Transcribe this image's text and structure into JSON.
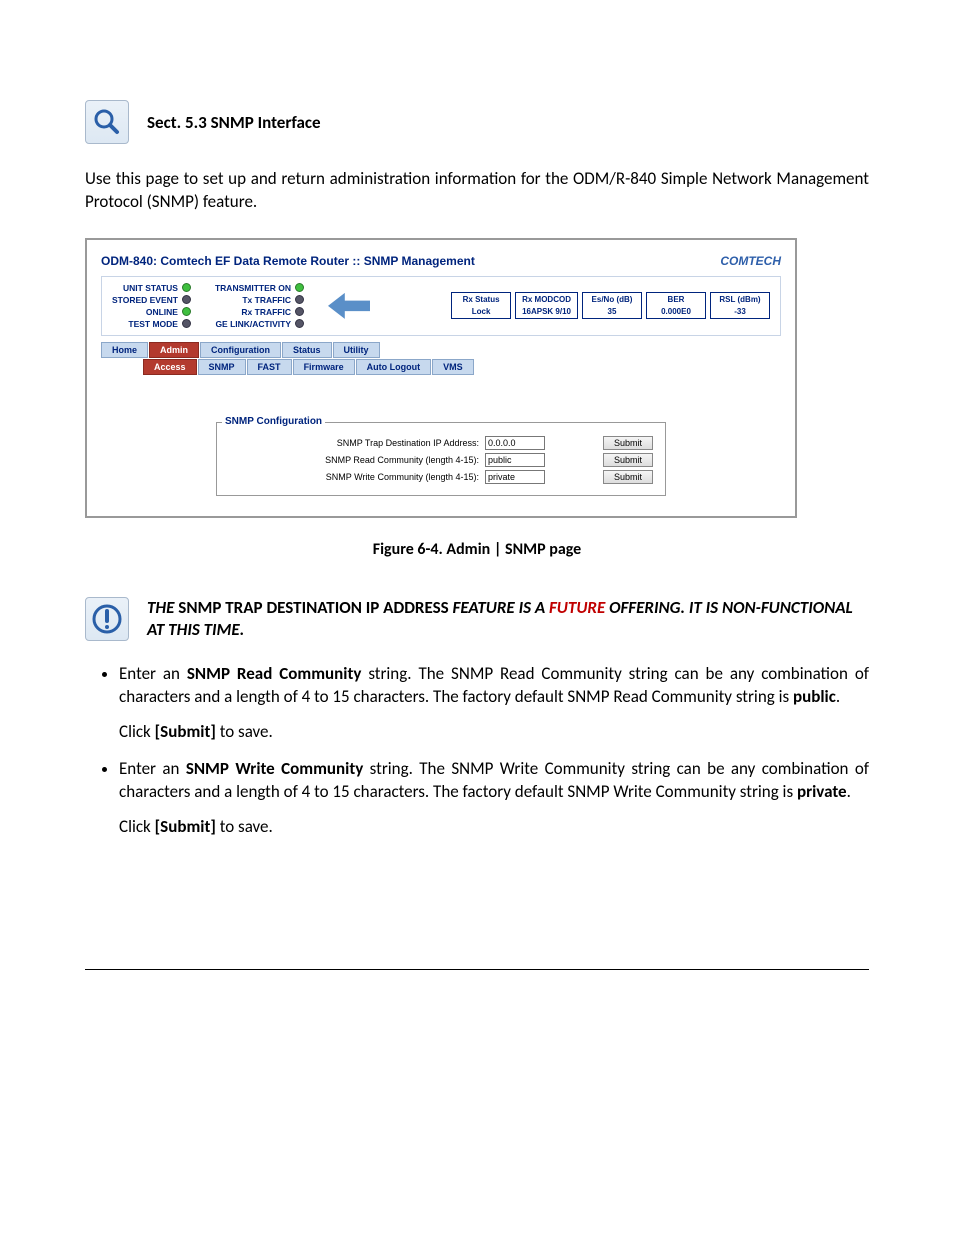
{
  "intro": {
    "heading": "Sect. 5.3 SNMP Interface",
    "paragraph": "Use this page to set up and return administration information for the ODM/R-840 Simple Network Management Protocol (SNMP) feature."
  },
  "screenshot": {
    "title": "ODM-840: Comtech EF Data Remote Router :: SNMP Management",
    "logo": "COMTECH",
    "status_left": [
      "UNIT STATUS",
      "STORED EVENT",
      "ONLINE",
      "TEST MODE"
    ],
    "status_right": [
      "TRANSMITTER ON",
      "Tx TRAFFIC",
      "Rx TRAFFIC",
      "GE LINK/ACTIVITY"
    ],
    "metrics": [
      {
        "label": "Rx Status",
        "value": "Lock"
      },
      {
        "label": "Rx MODCOD",
        "value": "16APSK 9/10"
      },
      {
        "label": "Es/No (dB)",
        "value": "35"
      },
      {
        "label": "BER",
        "value": "0.000E0"
      },
      {
        "label": "RSL (dBm)",
        "value": "-33"
      }
    ],
    "tabs_main": [
      "Home",
      "Admin",
      "Configuration",
      "Status",
      "Utility"
    ],
    "tabs_sub": [
      "Access",
      "SNMP",
      "FAST",
      "Firmware",
      "Auto Logout",
      "VMS"
    ],
    "panel_title": "SNMP Configuration",
    "rows": [
      {
        "label": "SNMP Trap Destination IP Address:",
        "value": "0.0.0.0",
        "btn": "Submit"
      },
      {
        "label": "SNMP Read Community (length 4-15):",
        "value": "public",
        "btn": "Submit"
      },
      {
        "label": "SNMP Write Community (length 4-15):",
        "value": "private",
        "btn": "Submit"
      }
    ]
  },
  "caption": "Figure 6-4. Admin | SNMP page",
  "note": {
    "pre": "THE ",
    "t1": "SNMP TRAP DESTINATION IP ADDRESS",
    "t2": " FEATURE IS A ",
    "future": "FUTURE",
    "t3": " OFFERING. IT IS NON-FUNCTIONAL AT THIS TIME."
  },
  "bullets": {
    "b1a": "Enter an ",
    "b1b": "SNMP Read Community",
    "b1c": " string.  The SNMP Read Community string can be any combination of characters and a length of 4 to 15 characters. The factory default SNMP Read Community string is ",
    "b1d": "public",
    "b1e": ".",
    "click_a": "Click ",
    "click_b": "[Submit]",
    "click_c": " to save.",
    "b2a": "Enter an ",
    "b2b": "SNMP Write Community",
    "b2c": " string.  The SNMP Write Community string can be any combination of characters and a length of 4 to 15 characters. The factory default SNMP Write Community string is ",
    "b2d": "private",
    "b2e": "."
  }
}
